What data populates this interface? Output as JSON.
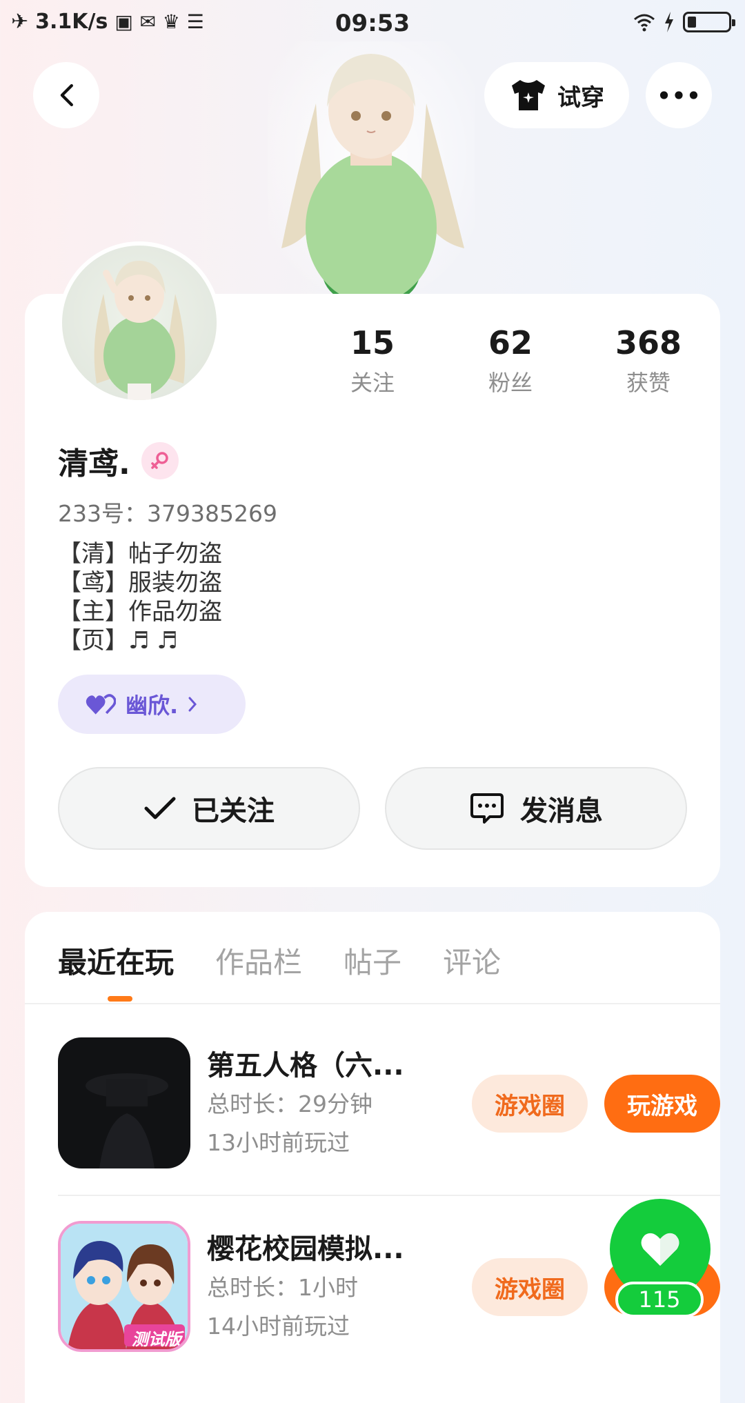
{
  "status_bar": {
    "network_speed": "3.1K/s",
    "time": "09:53"
  },
  "header": {
    "try_on_label": "试穿"
  },
  "profile": {
    "stats": [
      {
        "value": "15",
        "label": "关注"
      },
      {
        "value": "62",
        "label": "粉丝"
      },
      {
        "value": "368",
        "label": "获赞"
      }
    ],
    "nickname": "清鸢.",
    "uid": "233号：379385269",
    "bio": [
      "【清】帖子勿盗",
      "【鸢】服装勿盗",
      "【主】作品勿盗",
      "【页】♬ ♬"
    ],
    "guild_tag": "幽欣.",
    "follow_button": "已关注",
    "message_button": "发消息"
  },
  "tabs": [
    "最近在玩",
    "作品栏",
    "帖子",
    "评论"
  ],
  "games": [
    {
      "title": "第五人格（六...",
      "duration": "总时长：29分钟",
      "last_played": "13小时前玩过",
      "circle_label": "游戏圈",
      "play_label": "玩游戏"
    },
    {
      "title": "樱花校园模拟...",
      "duration": "总时长：1小时",
      "last_played": "14小时前玩过",
      "circle_label": "游戏圈",
      "play_label": "玩游戏",
      "icon_badge": "测试版"
    }
  ],
  "like": {
    "count": "115"
  },
  "colors": {
    "accent": "#ff6d12",
    "like_green": "#14cc3c",
    "guild_purple": "#6a57d6"
  }
}
